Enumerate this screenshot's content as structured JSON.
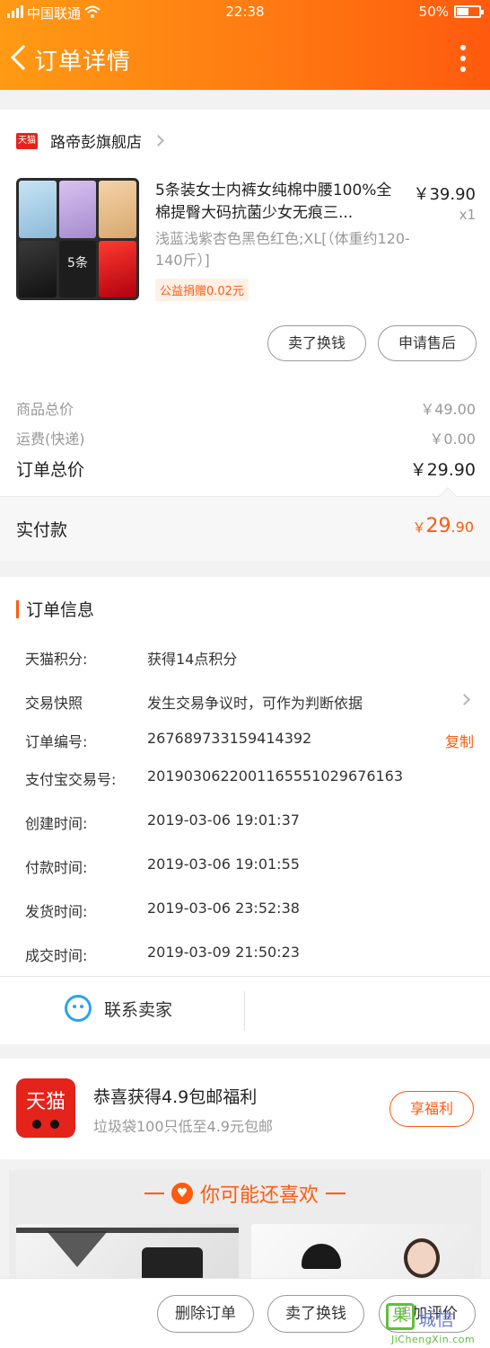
{
  "status_bar": {
    "carrier": "中国联通",
    "time": "22:38",
    "battery": "50%",
    "battery_level": 0.5
  },
  "header": {
    "title": "订单详情"
  },
  "store": {
    "badge": "天猫",
    "name": "路帝彭旗舰店"
  },
  "product": {
    "title": "5条装女士内裤女纯棉中腰100%全棉提臀大码抗菌少女无痕三...",
    "price": "￥39.90",
    "qty": "x1",
    "spec": "浅蓝浅紫杏色黑色红色;XL[（体重约120-140斤）]",
    "charity": "公益捐赠0.02元",
    "thumb_label": "5条"
  },
  "item_actions": {
    "sell": "卖了换钱",
    "after_sale": "申请售后"
  },
  "summary": {
    "goods_label": "商品总价",
    "goods_value": "￥49.00",
    "shipping_label": "运费(快递)",
    "shipping_value": "￥0.00",
    "total_label": "订单总价",
    "total_value": "￥29.90",
    "paid_label": "实付款",
    "paid_currency": "￥",
    "paid_int": "29",
    "paid_dec": ".90"
  },
  "order_info": {
    "title": "订单信息",
    "points_label": "天猫积分:",
    "points_value": "获得14点积分",
    "snapshot_label": "交易快照",
    "snapshot_value": "发生交易争议时，可作为判断依据",
    "order_no_label": "订单编号:",
    "order_no_value": "267689733159414392",
    "copy": "复制",
    "alipay_label": "支付宝交易号:",
    "alipay_value": "2019030622001165551029676163",
    "created_label": "创建时间:",
    "created_value": "2019-03-06 19:01:37",
    "paid_time_label": "付款时间:",
    "paid_time_value": "2019-03-06 19:01:55",
    "shipped_label": "发货时间:",
    "shipped_value": "2019-03-06 23:52:38",
    "completed_label": "成交时间:",
    "completed_value": "2019-03-09 21:50:23"
  },
  "contact": {
    "label": "联系卖家"
  },
  "promo": {
    "logo": "天猫",
    "title": "恭喜获得4.9包邮福利",
    "subtitle": "垃圾袋100只低至4.9元包邮",
    "button": "享福利"
  },
  "recommend": {
    "title": "你可能还喜欢"
  },
  "bottom_bar": {
    "delete": "删除订单",
    "sell": "卖了换钱",
    "review": "追加评价"
  },
  "watermark": {
    "glyph": "果",
    "text": "城信",
    "url": "JiChengXin.com"
  },
  "colors": {
    "accent": "#ff5a0e",
    "tmall_red": "#e4231b",
    "chat_blue": "#2aa3f0"
  }
}
